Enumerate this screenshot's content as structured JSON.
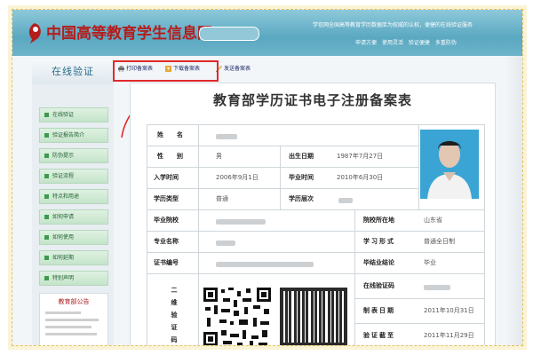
{
  "header": {
    "site_title": "中国高等教育学生信息网",
    "desc": "学信网全国高等教育学历数据库为权威的认权，便捷的在线验证服务",
    "slogan": [
      "申请方便",
      "使用灵活",
      "验证便捷",
      "多重防伪"
    ]
  },
  "sidebar": {
    "title": "在线验证",
    "items": [
      "在线验证",
      "验证报告简介",
      "防伪提示",
      "验证流程",
      "特点和用途",
      "如何申请",
      "如何使用",
      "如何延期",
      "特别声明"
    ],
    "notice_title": "教育部公告"
  },
  "toolbar": {
    "print_label": "打印备案表",
    "download_label": "下载备案表",
    "send_label": "发送备案表"
  },
  "document": {
    "title": "教育部学历证书电子注册备案表",
    "labels": {
      "name": "姓　名",
      "gender": "性　别",
      "birth": "出生日期",
      "enroll": "入学时间",
      "graduate": "毕业时间",
      "edu_type": "学历类型",
      "edu_level": "学历层次",
      "school": "毕业院校",
      "school_location": "院校所在地",
      "major": "专业名称",
      "study_form": "学习形式",
      "cert_no": "证书编号",
      "conclusion": "毕结业结论",
      "qr": "二维验证码",
      "verify_code": "在线验证码",
      "issue_date": "制表日期",
      "valid_until": "验证截至"
    },
    "values": {
      "gender": "男",
      "birth": "1987年7月27日",
      "enroll": "2006年9月1日",
      "graduate": "2010年6月30日",
      "edu_type": "普通",
      "school_location": "山东省",
      "study_form": "普通全日制",
      "conclusion": "毕业",
      "issue_date": "2011年10月31日",
      "valid_until": "2011年11月29日"
    }
  },
  "colors": {
    "header_blue": "#5aa8c1",
    "title_red": "#b51d1d",
    "highlight_red": "#e02a2a",
    "menu_green": "#3c9a4f",
    "photo_blue": "#3aa5d4"
  }
}
